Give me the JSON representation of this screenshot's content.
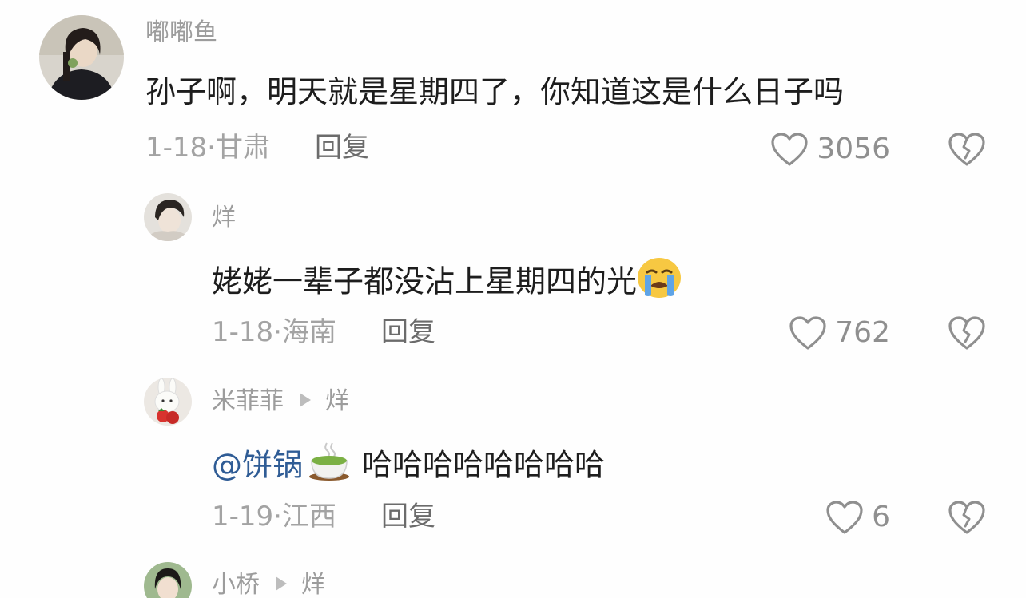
{
  "comments": [
    {
      "username": "嘟嘟鱼",
      "reply_to": "",
      "mention": "",
      "text": "孙子啊，明天就是星期四了，你知道这是什么日子吗",
      "date": "1-18",
      "location": "甘肃",
      "reply_label": "回复",
      "likes": "3056",
      "emoji": ""
    },
    {
      "username": "烊",
      "reply_to": "",
      "mention": "",
      "text": "姥姥一辈子都没沾上星期四的光",
      "date": "1-18",
      "location": "海南",
      "reply_label": "回复",
      "likes": "762",
      "emoji": "loudly-crying-face"
    },
    {
      "username": "米菲菲",
      "reply_to": "烊",
      "mention": "@饼锅",
      "text": "哈哈哈哈哈哈哈哈",
      "date": "1-19",
      "location": "江西",
      "reply_label": "回复",
      "likes": "6",
      "emoji": "green-tea-cup"
    },
    {
      "username": "小桥",
      "reply_to": "烊",
      "mention": "",
      "text": "",
      "date": "",
      "location": "",
      "reply_label": "",
      "likes": "",
      "emoji": ""
    }
  ],
  "colors": {
    "username": "#9c9c9c",
    "mention": "#2f5c95",
    "meta": "#a3a3a3",
    "reply": "#6b6b6b",
    "icon": "#8f8f8f"
  }
}
